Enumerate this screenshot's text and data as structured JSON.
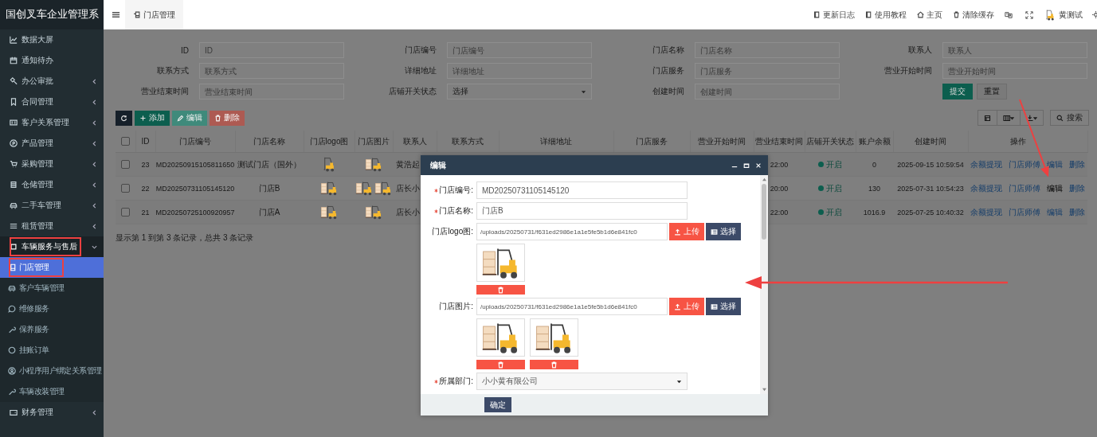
{
  "sidebar": {
    "title": "国创叉车企业管理系",
    "items": [
      {
        "label": "数据大屏",
        "kind": "link",
        "selected": false,
        "marked": false
      },
      {
        "label": "通知待办",
        "kind": "link",
        "selected": false,
        "marked": false
      },
      {
        "label": "办公审批",
        "kind": "group",
        "expanded": false,
        "selected": false,
        "marked": false
      },
      {
        "label": "合同管理",
        "kind": "group",
        "expanded": false,
        "selected": false,
        "marked": false
      },
      {
        "label": "客户关系管理",
        "kind": "group",
        "expanded": false,
        "selected": false,
        "marked": false
      },
      {
        "label": "产品管理",
        "kind": "group",
        "expanded": false,
        "selected": false,
        "marked": false
      },
      {
        "label": "采购管理",
        "kind": "group",
        "expanded": false,
        "selected": false,
        "marked": false
      },
      {
        "label": "仓储管理",
        "kind": "group",
        "expanded": false,
        "selected": false,
        "marked": false
      },
      {
        "label": "二手车管理",
        "kind": "group",
        "expanded": false,
        "selected": false,
        "marked": false
      },
      {
        "label": "租赁管理",
        "kind": "group",
        "expanded": false,
        "selected": false,
        "marked": false
      },
      {
        "label": "车辆服务与售后",
        "kind": "group",
        "expanded": true,
        "selected": false,
        "marked": true,
        "children": [
          {
            "label": "门店管理",
            "selected": true,
            "marked": true
          },
          {
            "label": "客户车辆管理",
            "selected": false,
            "marked": false
          },
          {
            "label": "维修服务",
            "selected": false,
            "marked": false
          },
          {
            "label": "保养服务",
            "selected": false,
            "marked": false
          },
          {
            "label": "挂账订单",
            "selected": false,
            "marked": false
          },
          {
            "label": "小程序用户绑定关系管理",
            "selected": false,
            "marked": false
          },
          {
            "label": "车辆改装管理",
            "selected": false,
            "marked": false
          }
        ]
      },
      {
        "label": "财务管理",
        "kind": "group",
        "expanded": false,
        "selected": false,
        "marked": false
      }
    ]
  },
  "topbar": {
    "tab": "门店管理",
    "links": [
      "更新日志",
      "使用教程",
      "主页",
      "清除缓存"
    ],
    "user": "黄测试"
  },
  "filters": [
    {
      "label": "ID",
      "kind": "text",
      "placeholder": "ID"
    },
    {
      "label": "门店编号",
      "kind": "text",
      "placeholder": "门店编号"
    },
    {
      "label": "门店名称",
      "kind": "text",
      "placeholder": "门店名称"
    },
    {
      "label": "联系人",
      "kind": "text",
      "placeholder": "联系人"
    },
    {
      "label": "联系方式",
      "kind": "text",
      "placeholder": "联系方式"
    },
    {
      "label": "详细地址",
      "kind": "text",
      "placeholder": "详细地址"
    },
    {
      "label": "门店服务",
      "kind": "text",
      "placeholder": "门店服务"
    },
    {
      "label": "营业开始时间",
      "kind": "text",
      "placeholder": "营业开始时间"
    },
    {
      "label": "营业结束时间",
      "kind": "text",
      "placeholder": "营业结束时间"
    },
    {
      "label": "店铺开关状态",
      "kind": "select",
      "value": "选择"
    },
    {
      "label": "创建时间",
      "kind": "text",
      "placeholder": "创建时间"
    }
  ],
  "filter_buttons": [
    {
      "label": "提交",
      "kind": "primary"
    },
    {
      "label": "重置",
      "kind": "default"
    }
  ],
  "toolbar": [
    {
      "kind": "refresh",
      "disabled": false
    },
    {
      "kind": "add",
      "label": "添加",
      "disabled": false
    },
    {
      "kind": "edit",
      "label": "编辑",
      "disabled": true
    },
    {
      "kind": "delete",
      "label": "删除",
      "disabled": true
    }
  ],
  "search_button": "搜索",
  "table": {
    "header_checked": false,
    "columns": [
      "ID",
      "门店编号",
      "门店名称",
      "门店logo图",
      "门店图片",
      "联系人",
      "联系方式",
      "详细地址",
      "门店服务",
      "营业开始时间",
      "营业结束时间",
      "店铺开关状态",
      "账户余额",
      "创建时间",
      "操作"
    ],
    "rows": [
      {
        "checked": false,
        "id": "23",
        "code": "MD20250915105811650",
        "name": "测试门店（国外）",
        "logo": [
          {
            "kind": "forklift"
          }
        ],
        "images": [
          {
            "kind": "forklift-boxes"
          }
        ],
        "contact": "黄浩起",
        "end_time": "22:00",
        "status": {
          "label": "开启",
          "color": "#0c5e4e"
        },
        "balance": "0",
        "created": "2025-09-15 10:59:54",
        "actions": [
          {
            "label": "余额提现",
            "hovered": false
          },
          {
            "label": "门店师傅",
            "hovered": false
          },
          {
            "label": "编辑",
            "hovered": false
          },
          {
            "label": "删除",
            "hovered": false
          }
        ]
      },
      {
        "checked": false,
        "id": "22",
        "code": "MD20250731105145120",
        "name": "门店B",
        "logo": [
          {
            "kind": "forklift-boxes"
          }
        ],
        "images": [
          {
            "kind": "forklift-boxes"
          },
          {
            "kind": "forklift-boxes"
          }
        ],
        "contact": "店长小",
        "end_time": "20:00",
        "status": {
          "label": "开启",
          "color": "#0c5e4e"
        },
        "balance": "130",
        "created": "2025-07-31 10:54:23",
        "actions": [
          {
            "label": "余额提现",
            "hovered": false
          },
          {
            "label": "门店师傅",
            "hovered": false
          },
          {
            "label": "编辑",
            "hovered": true
          },
          {
            "label": "删除",
            "hovered": false
          }
        ]
      },
      {
        "checked": false,
        "id": "21",
        "code": "MD20250725100920957",
        "name": "门店A",
        "logo": [
          {
            "kind": "forklift-boxes"
          }
        ],
        "images": [
          {
            "kind": "forklift-boxes"
          }
        ],
        "contact": "店长小",
        "end_time": "22:00",
        "status": {
          "label": "开启",
          "color": "#0c5e4e"
        },
        "balance": "1016.9",
        "created": "2025-07-25 10:40:32",
        "actions": [
          {
            "label": "余额提现",
            "hovered": false
          },
          {
            "label": "门店师傅",
            "hovered": false
          },
          {
            "label": "编辑",
            "hovered": false
          },
          {
            "label": "删除",
            "hovered": false
          }
        ]
      }
    ]
  },
  "pagination": "显示第 1 到第 3 条记录，总共 3 条记录",
  "modal": {
    "title": "编辑",
    "fields": [
      {
        "kind": "text",
        "label": "门店编号:",
        "required": true,
        "value": "MD20250731105145120"
      },
      {
        "kind": "text",
        "label": "门店名称:",
        "required": true,
        "value": "门店B"
      },
      {
        "kind": "upload",
        "label": "门店logo图:",
        "required": false,
        "value": "/uploads/20250731/f631ed2986e1a1e5fe5b1d6e841fc0",
        "buttons": [
          "上传",
          "选择"
        ],
        "images": [
          {
            "kind": "forklift-boxes"
          }
        ]
      },
      {
        "kind": "upload",
        "label": "门店图片:",
        "required": false,
        "value": "/uploads/20250731/f631ed2986e1a1e5fe5b1d6e841fc0",
        "buttons": [
          "上传",
          "选择"
        ],
        "images": [
          {
            "kind": "forklift-boxes"
          },
          {
            "kind": "forklift-boxes"
          }
        ]
      },
      {
        "kind": "select",
        "label": "所属部门:",
        "required": true,
        "value": "小小黄有限公司"
      }
    ],
    "submit": "确定"
  }
}
